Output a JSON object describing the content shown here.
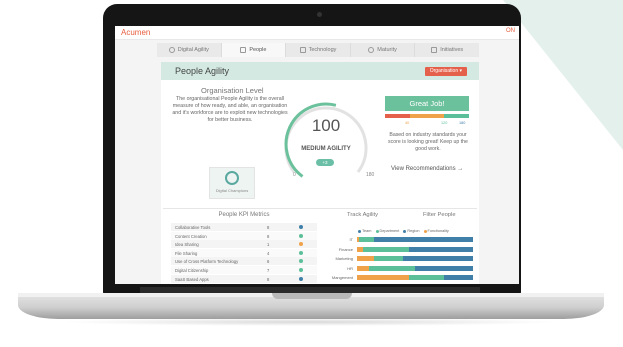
{
  "app": {
    "brand": "Acumen",
    "header_right": "ON"
  },
  "tabs": [
    {
      "label": "Digital Agility",
      "icon": "smiley-icon"
    },
    {
      "label": "People",
      "icon": "people-icon"
    },
    {
      "label": "Technology",
      "icon": "monitor-icon"
    },
    {
      "label": "Maturity",
      "icon": "clock-icon"
    },
    {
      "label": "Initiatives",
      "icon": "document-icon"
    }
  ],
  "panel": {
    "title": "People Agility",
    "filter_button": "Organisation ▾"
  },
  "org": {
    "heading": "Organisation Level",
    "description": "The organisational People Agility is the overall measure of how ready, and able, an organisation and it's workforce are to exploit new technologies for better business.",
    "badge_label": "Digital Champions"
  },
  "gauge": {
    "score": "100",
    "level": "MEDIUM AGILITY",
    "delta": "+3",
    "min": "0",
    "max": "180",
    "fraction": 0.55
  },
  "result": {
    "banner": "Great Job!",
    "ticks": [
      "40",
      "120",
      "180"
    ],
    "summary": "Based on industry standards your score is looking great! Keep up the good work.",
    "link": "View Recommendations →"
  },
  "kpi": {
    "title": "People KPI Metrics",
    "rows": [
      {
        "name": "Collaborative Tools",
        "value": "8",
        "color": "#3f7fa8"
      },
      {
        "name": "Content Creation",
        "value": "8",
        "color": "#5bbf9a"
      },
      {
        "name": "Idea Sharing",
        "value": "1",
        "color": "#f0a24a"
      },
      {
        "name": "File Sharing",
        "value": "4",
        "color": "#5bbf9a"
      },
      {
        "name": "Use of Cross Platform Technology",
        "value": "6",
        "color": "#5bbf9a"
      },
      {
        "name": "Digital Citizenship",
        "value": "7",
        "color": "#5bbf9a"
      },
      {
        "name": "SaaS Based Apps",
        "value": "8",
        "color": "#3f7fa8"
      }
    ]
  },
  "track": {
    "tab1": "Track Agility",
    "tab2": "Filter People",
    "legend": [
      "Team",
      "Department",
      "Region",
      "Functionality"
    ],
    "legend_colors": [
      "#3f7fa8",
      "#5bbf9a",
      "#3f7fa8",
      "#f0a24a"
    ]
  },
  "chart_data": {
    "type": "bar",
    "stacked": true,
    "categories": [
      "IT",
      "Finance",
      "Marketing",
      "HR",
      "Mangement"
    ],
    "series": [
      {
        "name": "Functionality",
        "color": "#f0a24a",
        "values": [
          2,
          5,
          15,
          10,
          45
        ]
      },
      {
        "name": "Department",
        "color": "#5bbf9a",
        "values": [
          13,
          40,
          25,
          40,
          30
        ]
      },
      {
        "name": "Team",
        "color": "#3f7fa8",
        "values": [
          85,
          55,
          60,
          50,
          25
        ]
      }
    ],
    "title": "",
    "xlabel": "",
    "ylabel": ""
  }
}
